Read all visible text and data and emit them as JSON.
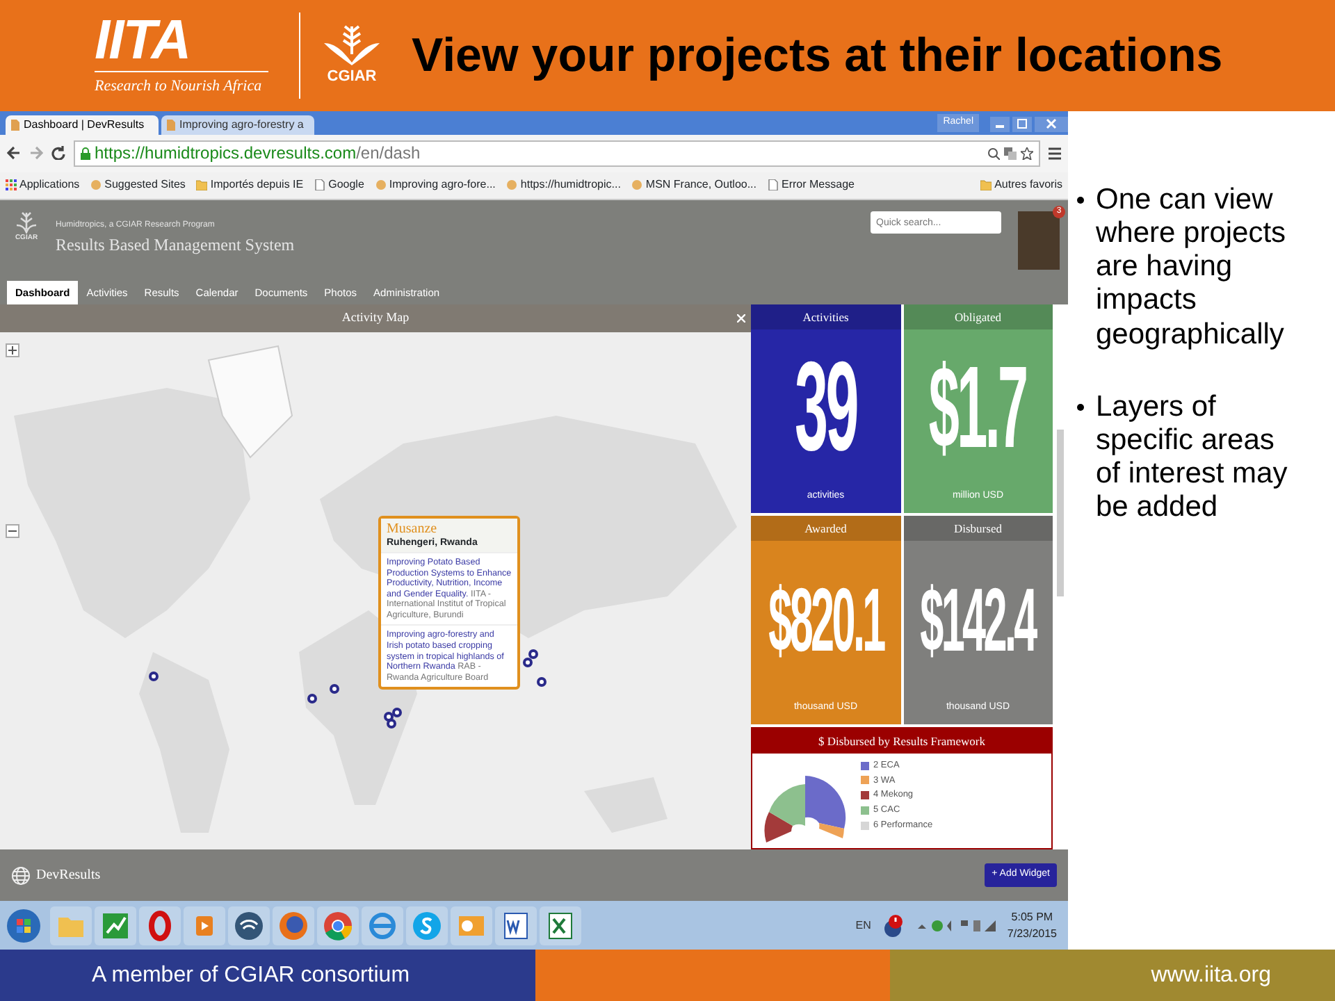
{
  "slide": {
    "logo_text": "IITA",
    "logo_tagline": "Research to Nourish Africa",
    "partner_logo_text": "CGIAR",
    "title": "View your projects at their locations"
  },
  "browser": {
    "tabs": [
      {
        "label": "Dashboard | DevResults",
        "selected": true
      },
      {
        "label": "Improving agro-forestry a",
        "selected": false
      }
    ],
    "user": "Rachel",
    "url_host": "https://humidtropics.devresults.com",
    "url_path": "/en/dash",
    "bookmarks": [
      {
        "label": "Applications",
        "kind": "apps"
      },
      {
        "label": "Suggested Sites",
        "kind": "site"
      },
      {
        "label": "Importés depuis IE",
        "kind": "folder"
      },
      {
        "label": "Google",
        "kind": "page"
      },
      {
        "label": "Improving agro-fore...",
        "kind": "site"
      },
      {
        "label": "https://humidtropic...",
        "kind": "site"
      },
      {
        "label": "MSN France, Outloo...",
        "kind": "site"
      },
      {
        "label": "Error Message",
        "kind": "page"
      }
    ],
    "other_bookmarks": "Autres favoris"
  },
  "app": {
    "logo_text": "CGIAR",
    "org": "Humidtropics, a CGIAR Research Program",
    "title": "Results Based Management System",
    "search": {
      "placeholder": "Quick search..."
    },
    "notification_count": "3",
    "nav": [
      {
        "label": "Dashboard",
        "selected": true
      },
      {
        "label": "Activities",
        "selected": false
      },
      {
        "label": "Results",
        "selected": false
      },
      {
        "label": "Calendar",
        "selected": false
      },
      {
        "label": "Documents",
        "selected": false
      },
      {
        "label": "Photos",
        "selected": false
      },
      {
        "label": "Administration",
        "selected": false
      }
    ]
  },
  "map": {
    "title": "Activity Map",
    "popup": {
      "place": "Musanze",
      "region": "Ruhengeri, Rwanda",
      "projects": [
        {
          "title": "Improving Potato Based Production Systems to Enhance Productivity, Nutrition, Income and Gender Equality.",
          "org": "IITA - International Institut of Tropical Agriculture, Burundi"
        },
        {
          "title": "Improving agro-forestry and Irish potato based cropping system in tropical highlands of Northern Rwanda",
          "org": "RAB - Rwanda Agriculture Board"
        }
      ]
    }
  },
  "stats": [
    {
      "title": "Activities",
      "value": "39",
      "unit": "activities",
      "color": "#2626a6"
    },
    {
      "title": "Obligated",
      "value": "$1.7",
      "unit": "million USD",
      "color": "#67a96b"
    },
    {
      "title": "Awarded",
      "value": "$820.1",
      "unit": "thousand USD",
      "color": "#d9841e"
    },
    {
      "title": "Disbursed",
      "value": "$142.4",
      "unit": "thousand USD",
      "color": "#7f7f7d"
    }
  ],
  "framework": {
    "title": "$ Disbursed by Results Framework",
    "legend": [
      {
        "label": "2 ECA",
        "color": "#6b6bc9"
      },
      {
        "label": "3 WA",
        "color": "#eea256"
      },
      {
        "label": "4 Mekong",
        "color": "#a33a3a"
      },
      {
        "label": "5 CAC",
        "color": "#8dc08e"
      },
      {
        "label": "6 Performance",
        "color": "#d6d6d6"
      }
    ]
  },
  "app_footer": {
    "brand": "DevResults",
    "add_button": "+ Add Widget"
  },
  "taskbar": {
    "language": "EN",
    "time": "5:05 PM",
    "date": "7/23/2015"
  },
  "bullets": [
    "One can view where projects are having impacts geographically",
    "Layers of specific areas of interest may be added"
  ],
  "slide_footer": {
    "left": "A member of CGIAR consortium",
    "right": "www.iita.org"
  }
}
